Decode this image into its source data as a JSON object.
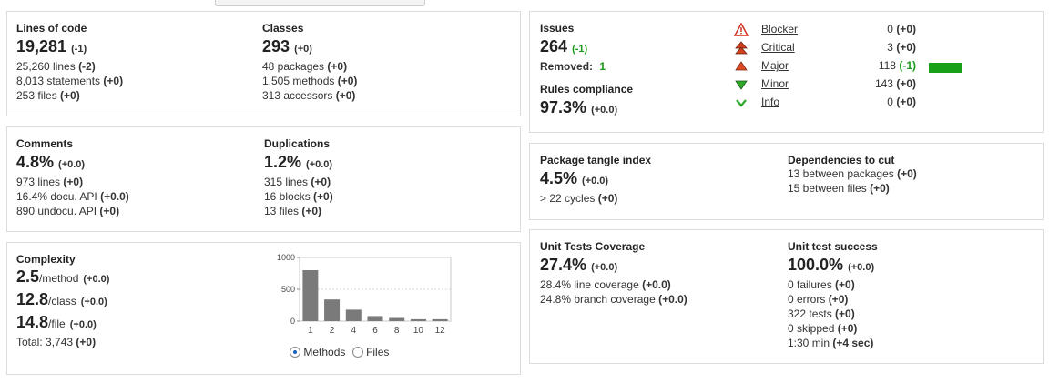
{
  "size": {
    "title": "Lines of code",
    "value": "19,281",
    "delta": "(-1)",
    "lines": [
      {
        "text": "25,260 lines",
        "delta": "(-2)"
      },
      {
        "text": "8,013 statements",
        "delta": "(+0)"
      },
      {
        "text": "253 files",
        "delta": "(+0)"
      }
    ]
  },
  "classes": {
    "title": "Classes",
    "value": "293",
    "delta": "(+0)",
    "lines": [
      {
        "text": "48 packages",
        "delta": "(+0)"
      },
      {
        "text": "1,505 methods",
        "delta": "(+0)"
      },
      {
        "text": "313 accessors",
        "delta": "(+0)"
      }
    ]
  },
  "comments": {
    "title": "Comments",
    "value": "4.8%",
    "delta": "(+0.0)",
    "lines": [
      {
        "text": "973 lines",
        "delta": "(+0)"
      },
      {
        "text": "16.4% docu. API",
        "delta": "(+0.0)"
      },
      {
        "text": "890 undocu. API",
        "delta": "(+0)"
      }
    ]
  },
  "duplications": {
    "title": "Duplications",
    "value": "1.2%",
    "delta": "(+0.0)",
    "lines": [
      {
        "text": "315 lines",
        "delta": "(+0)"
      },
      {
        "text": "16 blocks",
        "delta": "(+0)"
      },
      {
        "text": "13 files",
        "delta": "(+0)"
      }
    ]
  },
  "complexity": {
    "title": "Complexity",
    "rows": [
      {
        "value": "2.5",
        "unit": "/method",
        "delta": "(+0.0)"
      },
      {
        "value": "12.8",
        "unit": "/class",
        "delta": "(+0.0)"
      },
      {
        "value": "14.8",
        "unit": "/file",
        "delta": "(+0.0)"
      }
    ],
    "total": "Total: 3,743",
    "total_delta": "(+0)",
    "radio_methods": "Methods",
    "radio_files": "Files",
    "selected": "Methods"
  },
  "chart_data": {
    "type": "bar",
    "categories": [
      "1",
      "2",
      "4",
      "6",
      "8",
      "10",
      "12"
    ],
    "values": [
      800,
      340,
      180,
      80,
      50,
      30,
      30
    ],
    "ylim": [
      0,
      1000
    ],
    "yticks": [
      "0",
      "500",
      "1000"
    ],
    "grid": true
  },
  "issues": {
    "title": "Issues",
    "value": "264",
    "delta": "(-1)",
    "removed_label": "Removed:",
    "removed_value": "1",
    "rules_title": "Rules compliance",
    "rules_value": "97.3%",
    "rules_delta": "(+0.0)",
    "severities": [
      {
        "label": "Blocker",
        "count": "0",
        "delta": "(+0)",
        "icon": "blocker-icon",
        "bar": 0
      },
      {
        "label": "Critical",
        "count": "3",
        "delta": "(+0)",
        "icon": "critical-icon",
        "bar": 0
      },
      {
        "label": "Major",
        "count": "118",
        "delta": "(-1)",
        "icon": "major-icon",
        "bar": 1.0
      },
      {
        "label": "Minor",
        "count": "143",
        "delta": "(+0)",
        "icon": "minor-icon",
        "bar": 0
      },
      {
        "label": "Info",
        "count": "0",
        "delta": "(+0)",
        "icon": "info-icon",
        "bar": 0
      }
    ],
    "colors": {
      "bar": "#18a018",
      "green_delta": "#1a9a1a"
    }
  },
  "tangle": {
    "title": "Package tangle index",
    "value": "4.5%",
    "delta": "(+0.0)",
    "line_text": "> 22 cycles",
    "line_delta": "(+0)"
  },
  "deps": {
    "title": "Dependencies to cut",
    "lines": [
      {
        "text": "13 between packages",
        "delta": "(+0)"
      },
      {
        "text": "15 between files",
        "delta": "(+0)"
      }
    ]
  },
  "coverage": {
    "title": "Unit Tests Coverage",
    "value": "27.4%",
    "delta": "(+0.0)",
    "lines": [
      {
        "text": "28.4% line coverage",
        "delta": "(+0.0)"
      },
      {
        "text": "24.8% branch coverage",
        "delta": "(+0.0)"
      }
    ]
  },
  "success": {
    "title": "Unit test success",
    "value": "100.0%",
    "delta": "(+0.0)",
    "lines": [
      {
        "text": "0 failures",
        "delta": "(+0)"
      },
      {
        "text": "0 errors",
        "delta": "(+0)"
      },
      {
        "text": "322 tests",
        "delta": "(+0)"
      },
      {
        "text": "0 skipped",
        "delta": "(+0)"
      },
      {
        "text": "1:30 min",
        "delta": "(+4 sec)"
      }
    ]
  }
}
